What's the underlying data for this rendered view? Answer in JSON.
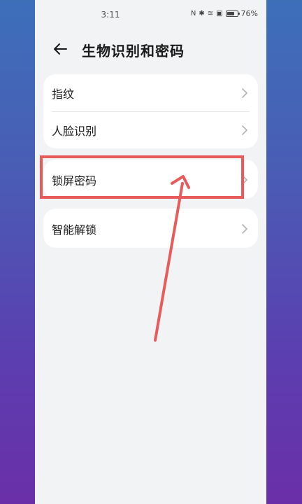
{
  "status_bar": {
    "time": "3:11",
    "nfc_glyph": "N",
    "bluetooth_glyph": "✱",
    "wifi_glyph": "≋",
    "sim_glyph": "▣",
    "battery_text": "76%",
    "battery_level": 0.76
  },
  "header": {
    "title": "生物识别和密码",
    "back_icon": "back-arrow-icon"
  },
  "groups": [
    {
      "items": [
        {
          "label": "指纹"
        },
        {
          "label": "人脸识别"
        }
      ]
    },
    {
      "items": [
        {
          "label": "锁屏密码"
        }
      ]
    },
    {
      "items": [
        {
          "label": "智能解锁"
        }
      ]
    }
  ],
  "colors": {
    "annotation": "#e85b5b",
    "background_top": "#3d6fb9",
    "background_bottom": "#6a2fa8",
    "screen_bg": "#f1f3f5",
    "card_bg": "#ffffff"
  }
}
